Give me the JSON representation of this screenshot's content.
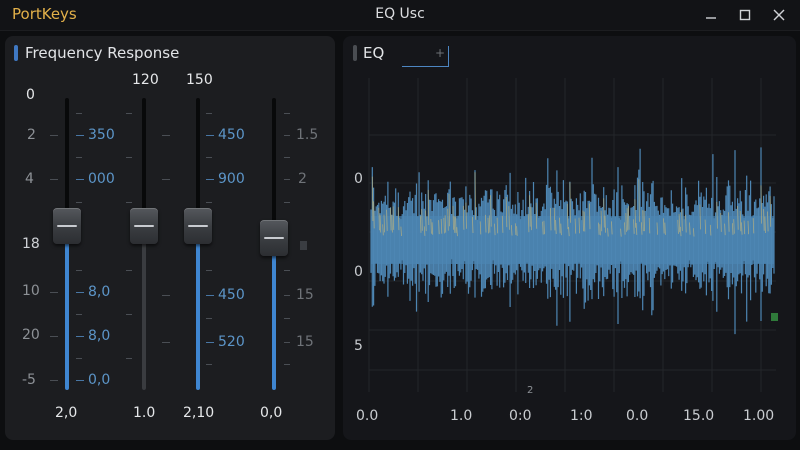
{
  "titlebar": {
    "app_name": "PortKeys",
    "title": "EQ Usc",
    "controls": [
      "minimize",
      "maximize",
      "close"
    ]
  },
  "left_panel": {
    "title": "Frequency Response",
    "accent_color": "#3f78c2",
    "top_labels": [
      "0",
      "120",
      "150"
    ],
    "left_scale": [
      "2",
      "4",
      "18",
      "10",
      "20",
      "-5"
    ],
    "col1_values": [
      "350",
      "000",
      "8,0",
      "8,0",
      "0,0"
    ],
    "col2_values": [
      "450",
      "900",
      "450",
      "520"
    ],
    "right_scale": [
      "1.5",
      "2",
      "15",
      "15"
    ],
    "sliders": [
      {
        "name": "slider-1",
        "level": 0.56,
        "fill_color": "#3f86d1",
        "bottom_label": "2,0"
      },
      {
        "name": "slider-2",
        "level": 0.56,
        "fill_color": "#3a3c40",
        "bottom_label": "1.0"
      },
      {
        "name": "slider-3",
        "level": 0.56,
        "fill_color": "#3f86d1",
        "bottom_label": "2,10"
      },
      {
        "name": "slider-4",
        "level": 0.52,
        "fill_color": "#3f86d1",
        "bottom_label": "0,0"
      }
    ]
  },
  "right_panel": {
    "title": "EQ",
    "tab_placeholder": "+",
    "y_labels": [
      "0",
      "0",
      "5"
    ],
    "x_labels": [
      "0.0",
      "1.0",
      "0:0",
      "1:0",
      "0.0",
      "15.0",
      "1.00"
    ],
    "mid_marker": "2",
    "wave_color": "#4d86b3",
    "wave_highlight": "#c9b97a"
  }
}
